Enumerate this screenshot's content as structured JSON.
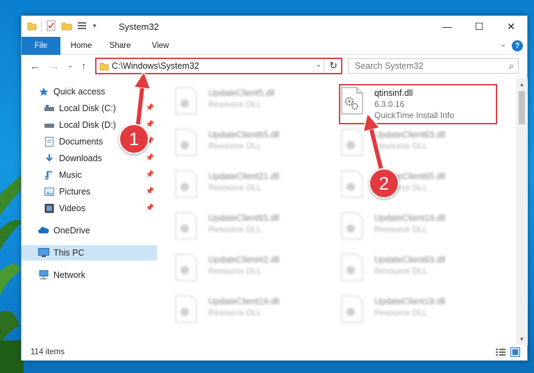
{
  "window": {
    "title": "System32",
    "controls": {
      "minimize": "—",
      "maximize": "☐",
      "close": "✕"
    }
  },
  "ribbon": {
    "tabs": [
      "File",
      "Home",
      "Share",
      "View"
    ],
    "help": "?"
  },
  "address": {
    "path": "C:\\Windows\\System32",
    "search_placeholder": "Search System32"
  },
  "nav": {
    "items": [
      {
        "label": "Quick access",
        "icon": "star-icon",
        "pinned": false
      },
      {
        "label": "Local Disk (C:)",
        "icon": "drive-icon",
        "pinned": true
      },
      {
        "label": "Local Disk (D:)",
        "icon": "drive-icon",
        "pinned": true
      },
      {
        "label": "Documents",
        "icon": "document-icon",
        "pinned": true
      },
      {
        "label": "Downloads",
        "icon": "download-icon",
        "pinned": true
      },
      {
        "label": "Music",
        "icon": "music-icon",
        "pinned": true
      },
      {
        "label": "Pictures",
        "icon": "pictures-icon",
        "pinned": true
      },
      {
        "label": "Videos",
        "icon": "videos-icon",
        "pinned": true
      },
      {
        "label": "OneDrive",
        "icon": "cloud-icon",
        "pinned": false
      },
      {
        "label": "This PC",
        "icon": "computer-icon",
        "pinned": false,
        "selected": true
      },
      {
        "label": "Network",
        "icon": "network-icon",
        "pinned": false
      }
    ]
  },
  "files": {
    "highlighted": {
      "name": "qtinsinf.dll",
      "version": "6.3.0.16",
      "description": "QuickTime Install Info"
    },
    "left_column": [
      {
        "name": "UpdateClient5.dll",
        "type": "Resource DLL"
      },
      {
        "name": "UpdateClient65.dll",
        "type": "Resource DLL"
      },
      {
        "name": "UpdateClient21.dll",
        "type": "Resource DLL"
      },
      {
        "name": "UpdateClient65.dll",
        "type": "Resource DLL"
      },
      {
        "name": "UpdateClient42.dll",
        "type": "Resource DLL"
      },
      {
        "name": "UpdateClient19.dll",
        "type": "Resource DLL"
      }
    ],
    "right_column": [
      {
        "name": "UpdateClient63.dll",
        "type": "Resource DLL"
      },
      {
        "name": "UpdateClient65.dll",
        "type": "Resource DLL"
      },
      {
        "name": "UpdateClient19.dll",
        "type": "Resource DLL"
      },
      {
        "name": "UpdateClient63.dll",
        "type": "Resource DLL"
      },
      {
        "name": "UpdateClient19.dll",
        "type": "Resource DLL"
      }
    ]
  },
  "status": {
    "item_count": "114 items"
  },
  "annotations": {
    "step1": "1",
    "step2": "2"
  },
  "colors": {
    "accent": "#1979ca",
    "highlight": "#d84048",
    "selected": "#cce4f7"
  }
}
